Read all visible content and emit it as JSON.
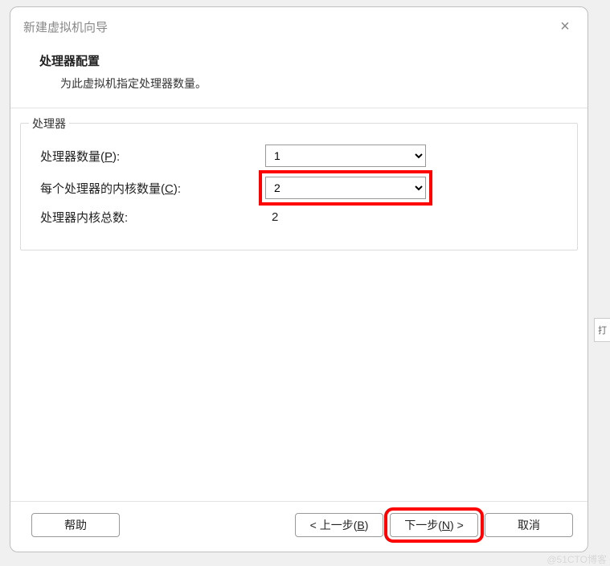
{
  "dialog": {
    "title": "新建虚拟机向导",
    "close_symbol": "×"
  },
  "header": {
    "title": "处理器配置",
    "subtitle": "为此虚拟机指定处理器数量。"
  },
  "group": {
    "legend": "处理器",
    "proc_count": {
      "label_prefix": "处理器数量(",
      "hotkey": "P",
      "label_suffix": "):",
      "value": "1"
    },
    "cores_per": {
      "label_prefix": "每个处理器的内核数量(",
      "hotkey": "C",
      "label_suffix": "):",
      "value": "2"
    },
    "total": {
      "label": "处理器内核总数:",
      "value": "2"
    }
  },
  "footer": {
    "help": "帮助",
    "back_prefix": "< 上一步(",
    "back_hotkey": "B",
    "back_suffix": ")",
    "next_prefix": "下一步(",
    "next_hotkey": "N",
    "next_suffix": ") >",
    "cancel": "取消"
  },
  "side_tab": "打",
  "watermark": "@51CTO博客"
}
